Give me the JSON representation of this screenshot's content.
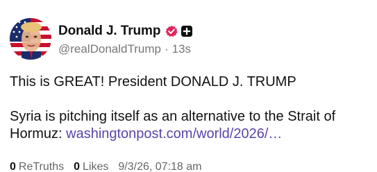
{
  "author": {
    "display_name": "Donald J. Trump",
    "handle": "@realDonaldTrump",
    "separator": "·",
    "time_ago": "13s",
    "verified_icon": "verified-badge-icon",
    "plus_icon": "plus-badge-icon"
  },
  "post": {
    "paragraph_1": "This is GREAT! President DONALD J. TRUMP",
    "paragraph_2_text": "Syria is pitching itself as an alternative to the Strait of Hormuz: ",
    "link_text": "washingtonpost.com/world/2026/…"
  },
  "stats": {
    "retruths_count": "0",
    "retruths_label": "ReTruths",
    "likes_count": "0",
    "likes_label": "Likes",
    "timestamp": "9/3/26, 07:18 am"
  },
  "colors": {
    "link": "#5a45a8",
    "verified": "#e0245e",
    "muted": "#777777"
  }
}
